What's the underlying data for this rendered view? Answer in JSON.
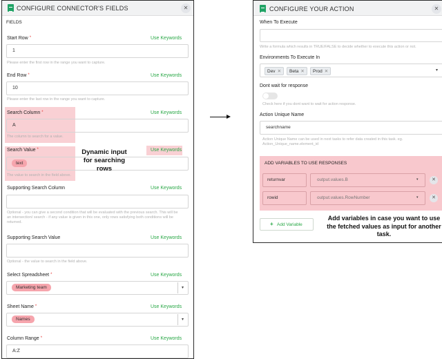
{
  "left": {
    "title": "CONFIGURE CONNECTOR'S FIELDS",
    "section": "FIELDS",
    "use_keywords": "Use Keywords",
    "start_row": {
      "label": "Start Row",
      "value": "1",
      "hint": "Please enter the first row in the range you want to capture."
    },
    "end_row": {
      "label": "End Row",
      "value": "10",
      "hint": "Please enter the last row in the range you want to capture."
    },
    "search_column": {
      "label": "Search Column",
      "value": "A",
      "hint": "The column to search for a value."
    },
    "search_value": {
      "label": "Search Value",
      "chip": "text",
      "hint": "The value to search in the field above."
    },
    "supporting_search_column": {
      "label": "Supporting Search Column",
      "hint1": "Optional - you can give a second condition that will be evaluated with the previous search. This will be",
      "hint2": "an intersection/ search - if any value is given in this one, only rows satisfying both conditions will be",
      "hint3": "returned."
    },
    "supporting_search_value": {
      "label": "Supporting Search Value",
      "hint": "Optional - the value to search in the field above."
    },
    "select_spreadsheet": {
      "label": "Select Spreadsheet",
      "chip": "Marketing team"
    },
    "sheet_name": {
      "label": "Sheet Name",
      "chip": "Names"
    },
    "column_range": {
      "label": "Column Range",
      "value": "A:Z"
    },
    "annotation": "Dynamic input for searching rows"
  },
  "right": {
    "title": "CONFIGURE YOUR ACTION",
    "when_to_execute": {
      "label": "When To Execute",
      "hint": "Write a formula which results in TRUE/FALSE to decide whether to execute this action or not."
    },
    "environments": {
      "label": "Environments To Execute In",
      "tags": [
        "Dev",
        "Beta",
        "Prod"
      ]
    },
    "dont_wait": {
      "label": "Dont wait for response",
      "hint": "Check here if you dont want to wait for action response."
    },
    "unique_name": {
      "label": "Action Unique Name",
      "value": "searchname",
      "hint1": "Action Unique Name can be used in next tasks to refer data created in this task. eg.",
      "hint2": "Action_Unique_name.element_id"
    },
    "variables": {
      "heading": "ADD VARIABLES TO USE RESPONSES",
      "rows": [
        {
          "name": "returnvar",
          "value": "output.values.B"
        },
        {
          "name": "rowid",
          "value": "output.values.RowNumber"
        }
      ]
    },
    "add_variable": "Add Variable",
    "annotation": "Add variables in case you want to use the fetched values as input for another task."
  },
  "colors": {
    "accent": "#28a745",
    "highlight": "#f8c8cd",
    "chip": "#f6a5ad",
    "sheets": "#21a366"
  }
}
